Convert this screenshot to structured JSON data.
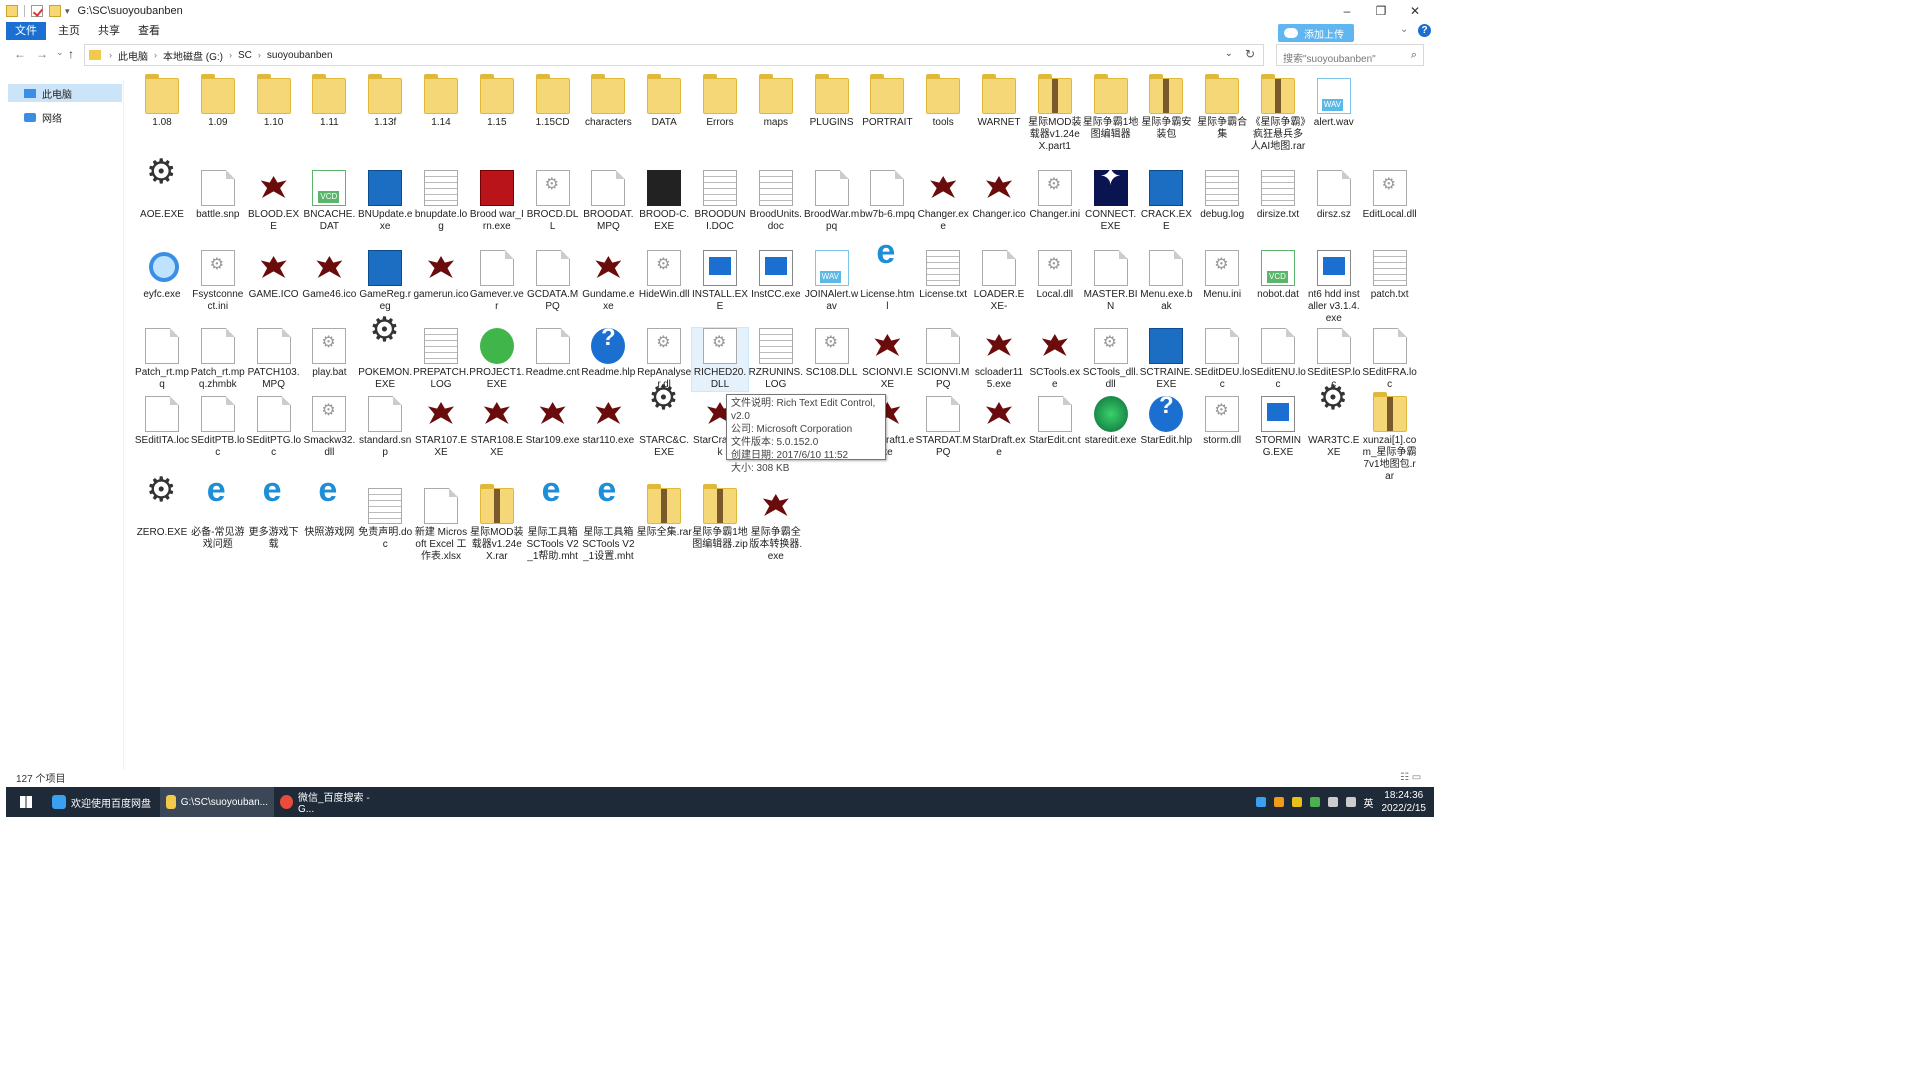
{
  "window": {
    "title": "G:\\SC\\suoyoubanben",
    "controls": [
      "–",
      "❐",
      "✕"
    ]
  },
  "ribbon": {
    "tabs": [
      "文件",
      "主页",
      "共享",
      "查看"
    ],
    "upload_label": "添加上传"
  },
  "nav": {
    "back": "←",
    "forward": "→",
    "recent": "⌄",
    "up": "↑",
    "breadcrumb": [
      "此电脑",
      "本地磁盘 (G:)",
      "SC",
      "suoyoubanben"
    ],
    "search_placeholder": "搜索\"suoyoubanben\""
  },
  "sidebar": {
    "items": [
      {
        "label": "此电脑"
      },
      {
        "label": "网络"
      }
    ]
  },
  "files": [
    {
      "name": "1.08",
      "type": "folder"
    },
    {
      "name": "1.09",
      "type": "folder"
    },
    {
      "name": "1.10",
      "type": "folder"
    },
    {
      "name": "1.11",
      "type": "folder"
    },
    {
      "name": "1.13f",
      "type": "folder"
    },
    {
      "name": "1.14",
      "type": "folder"
    },
    {
      "name": "1.15",
      "type": "folder"
    },
    {
      "name": "1.15CD",
      "type": "folder"
    },
    {
      "name": "characters",
      "type": "folder"
    },
    {
      "name": "DATA",
      "type": "folder"
    },
    {
      "name": "Errors",
      "type": "folder"
    },
    {
      "name": "maps",
      "type": "folder"
    },
    {
      "name": "PLUGINS",
      "type": "folder"
    },
    {
      "name": "PORTRAIT",
      "type": "folder"
    },
    {
      "name": "tools",
      "type": "folder"
    },
    {
      "name": "WARNET",
      "type": "folder"
    },
    {
      "name": "星际MOD装载器v1.24eX.part1",
      "type": "zip"
    },
    {
      "name": "星际争霸1地图编辑器",
      "type": "folder"
    },
    {
      "name": "星际争霸安装包",
      "type": "zip"
    },
    {
      "name": "星际争霸合集",
      "type": "folder"
    },
    {
      "name": "《星际争霸》疯狂悬兵多人AI地图.rar",
      "type": "zip"
    },
    {
      "name": "alert.wav",
      "type": "wav"
    },
    {
      "name": "AOE.EXE",
      "type": "gear"
    },
    {
      "name": "battle.snp",
      "type": "file"
    },
    {
      "name": "BLOOD.EXE",
      "type": "unit"
    },
    {
      "name": "BNCACHE.DAT",
      "type": "vcd"
    },
    {
      "name": "BNUpdate.exe",
      "type": "app-blue"
    },
    {
      "name": "bnupdate.log",
      "type": "text"
    },
    {
      "name": "Brood war_Irn.exe",
      "type": "app-red"
    },
    {
      "name": "BROCD.DLL",
      "type": "dll"
    },
    {
      "name": "BROODAT.MPQ",
      "type": "file"
    },
    {
      "name": "BROOD-C.EXE",
      "type": "app-black"
    },
    {
      "name": "BROODUNI.DOC",
      "type": "text"
    },
    {
      "name": "BroodUnits.doc",
      "type": "text"
    },
    {
      "name": "BroodWar.mpq",
      "type": "file"
    },
    {
      "name": "bw7b-6.mpq",
      "type": "file"
    },
    {
      "name": "Changer.exe",
      "type": "unit"
    },
    {
      "name": "Changer.ico",
      "type": "unit"
    },
    {
      "name": "Changer.ini",
      "type": "dll"
    },
    {
      "name": "CONNECT.EXE",
      "type": "spark"
    },
    {
      "name": "CRACK.EXE",
      "type": "app-blue"
    },
    {
      "name": "debug.log",
      "type": "text"
    },
    {
      "name": "dirsize.txt",
      "type": "text"
    },
    {
      "name": "dirsz.sz",
      "type": "file"
    },
    {
      "name": "EditLocal.dll",
      "type": "dll"
    },
    {
      "name": "eyfc.exe",
      "type": "magnify"
    },
    {
      "name": "Fsystconnect.ini",
      "type": "dll"
    },
    {
      "name": "GAME.ICO",
      "type": "unit"
    },
    {
      "name": "Game46.ico",
      "type": "unit"
    },
    {
      "name": "GameReg.reg",
      "type": "app-blue"
    },
    {
      "name": "gamerun.ico",
      "type": "unit"
    },
    {
      "name": "Gamever.ver",
      "type": "file"
    },
    {
      "name": "GCDATA.MPQ",
      "type": "file"
    },
    {
      "name": "Gundame.exe",
      "type": "unit"
    },
    {
      "name": "HideWin.dll",
      "type": "dll"
    },
    {
      "name": "INSTALL.EXE",
      "type": "win"
    },
    {
      "name": "InstCC.exe",
      "type": "win"
    },
    {
      "name": "JOINAlert.wav",
      "type": "wav"
    },
    {
      "name": "License.html",
      "type": "ie"
    },
    {
      "name": "License.txt",
      "type": "text"
    },
    {
      "name": "LOADER.EXE-",
      "type": "file"
    },
    {
      "name": "Local.dll",
      "type": "dll"
    },
    {
      "name": "MASTER.BIN",
      "type": "file"
    },
    {
      "name": "Menu.exe.bak",
      "type": "file"
    },
    {
      "name": "Menu.ini",
      "type": "dll"
    },
    {
      "name": "nobot.dat",
      "type": "vcd"
    },
    {
      "name": "nt6 hdd installer v3.1.4.exe",
      "type": "win"
    },
    {
      "name": "patch.txt",
      "type": "text"
    },
    {
      "name": "Patch_rt.mpq",
      "type": "file"
    },
    {
      "name": "Patch_rt.mpq.zhmbk",
      "type": "file"
    },
    {
      "name": "PATCH103.MPQ",
      "type": "file"
    },
    {
      "name": "play.bat",
      "type": "dll"
    },
    {
      "name": "POKEMON.EXE",
      "type": "gear"
    },
    {
      "name": "PREPATCH.LOG",
      "type": "text"
    },
    {
      "name": "PROJECT1.EXE",
      "type": "app-green"
    },
    {
      "name": "Readme.cnt",
      "type": "file"
    },
    {
      "name": "Readme.hlp",
      "type": "help"
    },
    {
      "name": "RepAnalyser.dl",
      "type": "dll"
    },
    {
      "name": "RICHED20.DLL",
      "type": "dll"
    },
    {
      "name": "RZRUNINS.LOG",
      "type": "text"
    },
    {
      "name": "SC108.DLL",
      "type": "dll"
    },
    {
      "name": "SCIONVI.EXE",
      "type": "unit"
    },
    {
      "name": "SCIONVI.MPQ",
      "type": "file"
    },
    {
      "name": "scloader115.exe",
      "type": "unit"
    },
    {
      "name": "SCTools.exe",
      "type": "unit"
    },
    {
      "name": "SCTools_dll.dll",
      "type": "dll"
    },
    {
      "name": "SCTRAINE.EXE",
      "type": "app-blue"
    },
    {
      "name": "SEditDEU.loc",
      "type": "file"
    },
    {
      "name": "SEditENU.loc",
      "type": "file"
    },
    {
      "name": "SEditESP.loc",
      "type": "file"
    },
    {
      "name": "SEditFRA.loc",
      "type": "file"
    },
    {
      "name": "SEditITA.loc",
      "type": "file"
    },
    {
      "name": "SEditPTB.loc",
      "type": "file"
    },
    {
      "name": "SEditPTG.loc",
      "type": "file"
    },
    {
      "name": "Smackw32.dll",
      "type": "dll"
    },
    {
      "name": "standard.snp",
      "type": "file"
    },
    {
      "name": "STAR107.EXE",
      "type": "unit"
    },
    {
      "name": "STAR108.EXE",
      "type": "unit"
    },
    {
      "name": "Star109.exe",
      "type": "unit"
    },
    {
      "name": "star110.exe",
      "type": "unit"
    },
    {
      "name": "STARC&C.EXE",
      "type": "gear"
    },
    {
      "name": "StarCraft.bak",
      "type": "unit"
    },
    {
      "name": "",
      "type": "none"
    },
    {
      "name": "",
      "type": "none"
    },
    {
      "name": "StarCraft1.exe",
      "type": "unit"
    },
    {
      "name": "STARDAT.MPQ",
      "type": "file"
    },
    {
      "name": "StarDraft.exe",
      "type": "unit"
    },
    {
      "name": "StarEdit.cnt",
      "type": "file"
    },
    {
      "name": "staredit.exe",
      "type": "globe"
    },
    {
      "name": "StarEdit.hlp",
      "type": "help"
    },
    {
      "name": "storm.dll",
      "type": "dll"
    },
    {
      "name": "STORMING.EXE",
      "type": "win"
    },
    {
      "name": "WAR3TC.EXE",
      "type": "gear"
    },
    {
      "name": "xunzai[1].com_星际争霸7v1地图包.rar",
      "type": "zip"
    },
    {
      "name": "ZERO.EXE",
      "type": "gear"
    },
    {
      "name": "必备-常见游戏问题",
      "type": "ie"
    },
    {
      "name": "更多游戏下载",
      "type": "ie"
    },
    {
      "name": "快照游戏网",
      "type": "ie"
    },
    {
      "name": "免责声明.doc",
      "type": "text"
    },
    {
      "name": "新建 Microsoft Excel 工作表.xlsx",
      "type": "file"
    },
    {
      "name": "星际MOD装载器v1.24eX.rar",
      "type": "zip"
    },
    {
      "name": "星际工具箱SCTools V2_1帮助.mht",
      "type": "ie"
    },
    {
      "name": "星际工具箱SCTools V2_1设置.mht",
      "type": "ie"
    },
    {
      "name": "星际全集.rar",
      "type": "zip"
    },
    {
      "name": "星际争霸1地图编辑器.zip",
      "type": "zip"
    },
    {
      "name": "星际争霸全版本转换器.exe",
      "type": "unit"
    }
  ],
  "tooltip": {
    "lines": [
      "文件说明: Rich Text Edit Control, v2.0",
      "公司: Microsoft Corporation",
      "文件版本: 5.0.152.0",
      "创建日期: 2017/6/10 11:52",
      "大小: 308 KB"
    ]
  },
  "status": {
    "count": "127 个项目"
  },
  "taskbar": {
    "tasks": [
      {
        "label": "欢迎使用百度网盘",
        "color": "#3aa0f0"
      },
      {
        "label": "G:\\SC\\suoyouban...",
        "color": "#f3c94c"
      },
      {
        "label": "微信_百度搜索 - G...",
        "color": "#e94b3c"
      }
    ],
    "ime": "英",
    "time": "18:24:36",
    "date": "2022/2/15"
  }
}
